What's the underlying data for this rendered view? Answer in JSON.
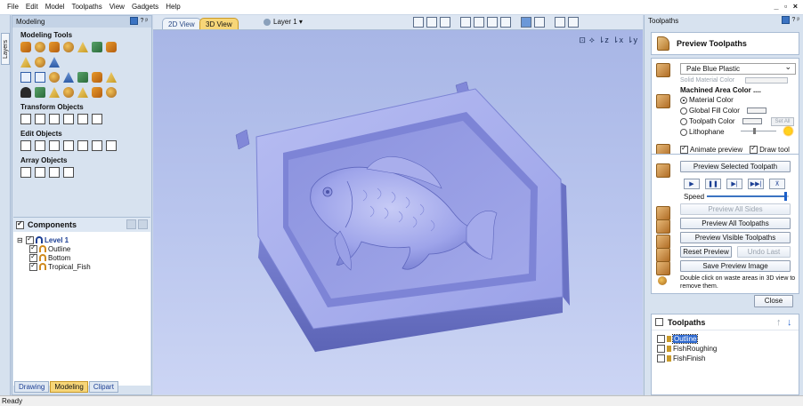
{
  "menu": [
    "File",
    "Edit",
    "Model",
    "Toolpaths",
    "View",
    "Gadgets",
    "Help"
  ],
  "window_controls": "_ ▫ ×",
  "layers_tab": "Layers",
  "left_panel": {
    "title": "Modeling",
    "header_buttons": "? ᵖ",
    "sections": {
      "modeling_tools": "Modeling Tools",
      "transform_objects": "Transform Objects",
      "edit_objects": "Edit Objects",
      "array_objects": "Array Objects"
    },
    "components": {
      "title": "Components",
      "items": [
        {
          "label": "Level 1",
          "level": 1,
          "checked": true
        },
        {
          "label": "Outline",
          "level": 2,
          "checked": true
        },
        {
          "label": "Bottom",
          "level": 2,
          "checked": true
        },
        {
          "label": "Tropical_Fish",
          "level": 2,
          "checked": true
        }
      ]
    },
    "bottom_tabs": [
      {
        "label": "Drawing",
        "active": false
      },
      {
        "label": "Modeling",
        "active": true
      },
      {
        "label": "Clipart",
        "active": false
      }
    ]
  },
  "view": {
    "tabs": [
      {
        "label": "2D View",
        "active": false
      },
      {
        "label": "3D View",
        "active": true
      }
    ],
    "layer_selector": "Layer 1 ▾"
  },
  "right_panel": {
    "title": "Toolpaths",
    "header_buttons": "? ᵖ",
    "preview": {
      "title": "Preview Toolpaths",
      "material_select": "Pale Blue Plastic",
      "solid_material_color": "Solid Material Color",
      "machined_area_title": "Machined Area Color ....",
      "color_options": [
        {
          "label": "Material Color",
          "selected": true
        },
        {
          "label": "Global Fill Color",
          "selected": false
        },
        {
          "label": "Toolpath Color",
          "selected": false
        },
        {
          "label": "Lithophane",
          "selected": false
        }
      ],
      "set_all": "Set All",
      "animate_preview": "Animate preview",
      "draw_tool": "Draw tool",
      "animate_checked": true,
      "draw_tool_checked": true,
      "preview_selected_toolpath": "Preview Selected Toolpath",
      "playback": [
        "▶",
        "❚❚",
        "▶|",
        "▶▶|",
        "⊼"
      ],
      "speed_label": "Speed",
      "speed_value": 0.97,
      "preview_all_sides": "Preview All Sides",
      "preview_all_toolpaths": "Preview All Toolpaths",
      "preview_visible_toolpaths": "Preview Visible Toolpaths",
      "reset_preview": "Reset Preview",
      "undo_last": "Undo Last",
      "save_preview_image": "Save Preview Image",
      "hint": "Double click on waste areas in 3D view to remove them.",
      "close": "Close"
    },
    "toolpaths": {
      "title": "Toolpaths",
      "items": [
        {
          "label": "Outline",
          "selected": true
        },
        {
          "label": "FishRoughing",
          "selected": false
        },
        {
          "label": "FishFinish",
          "selected": false
        }
      ]
    }
  },
  "status": "Ready",
  "colors": {
    "accent_tab": "#f7d678",
    "model_fill": "#8c93e0",
    "viewport_bg": "#b3c0ea"
  }
}
